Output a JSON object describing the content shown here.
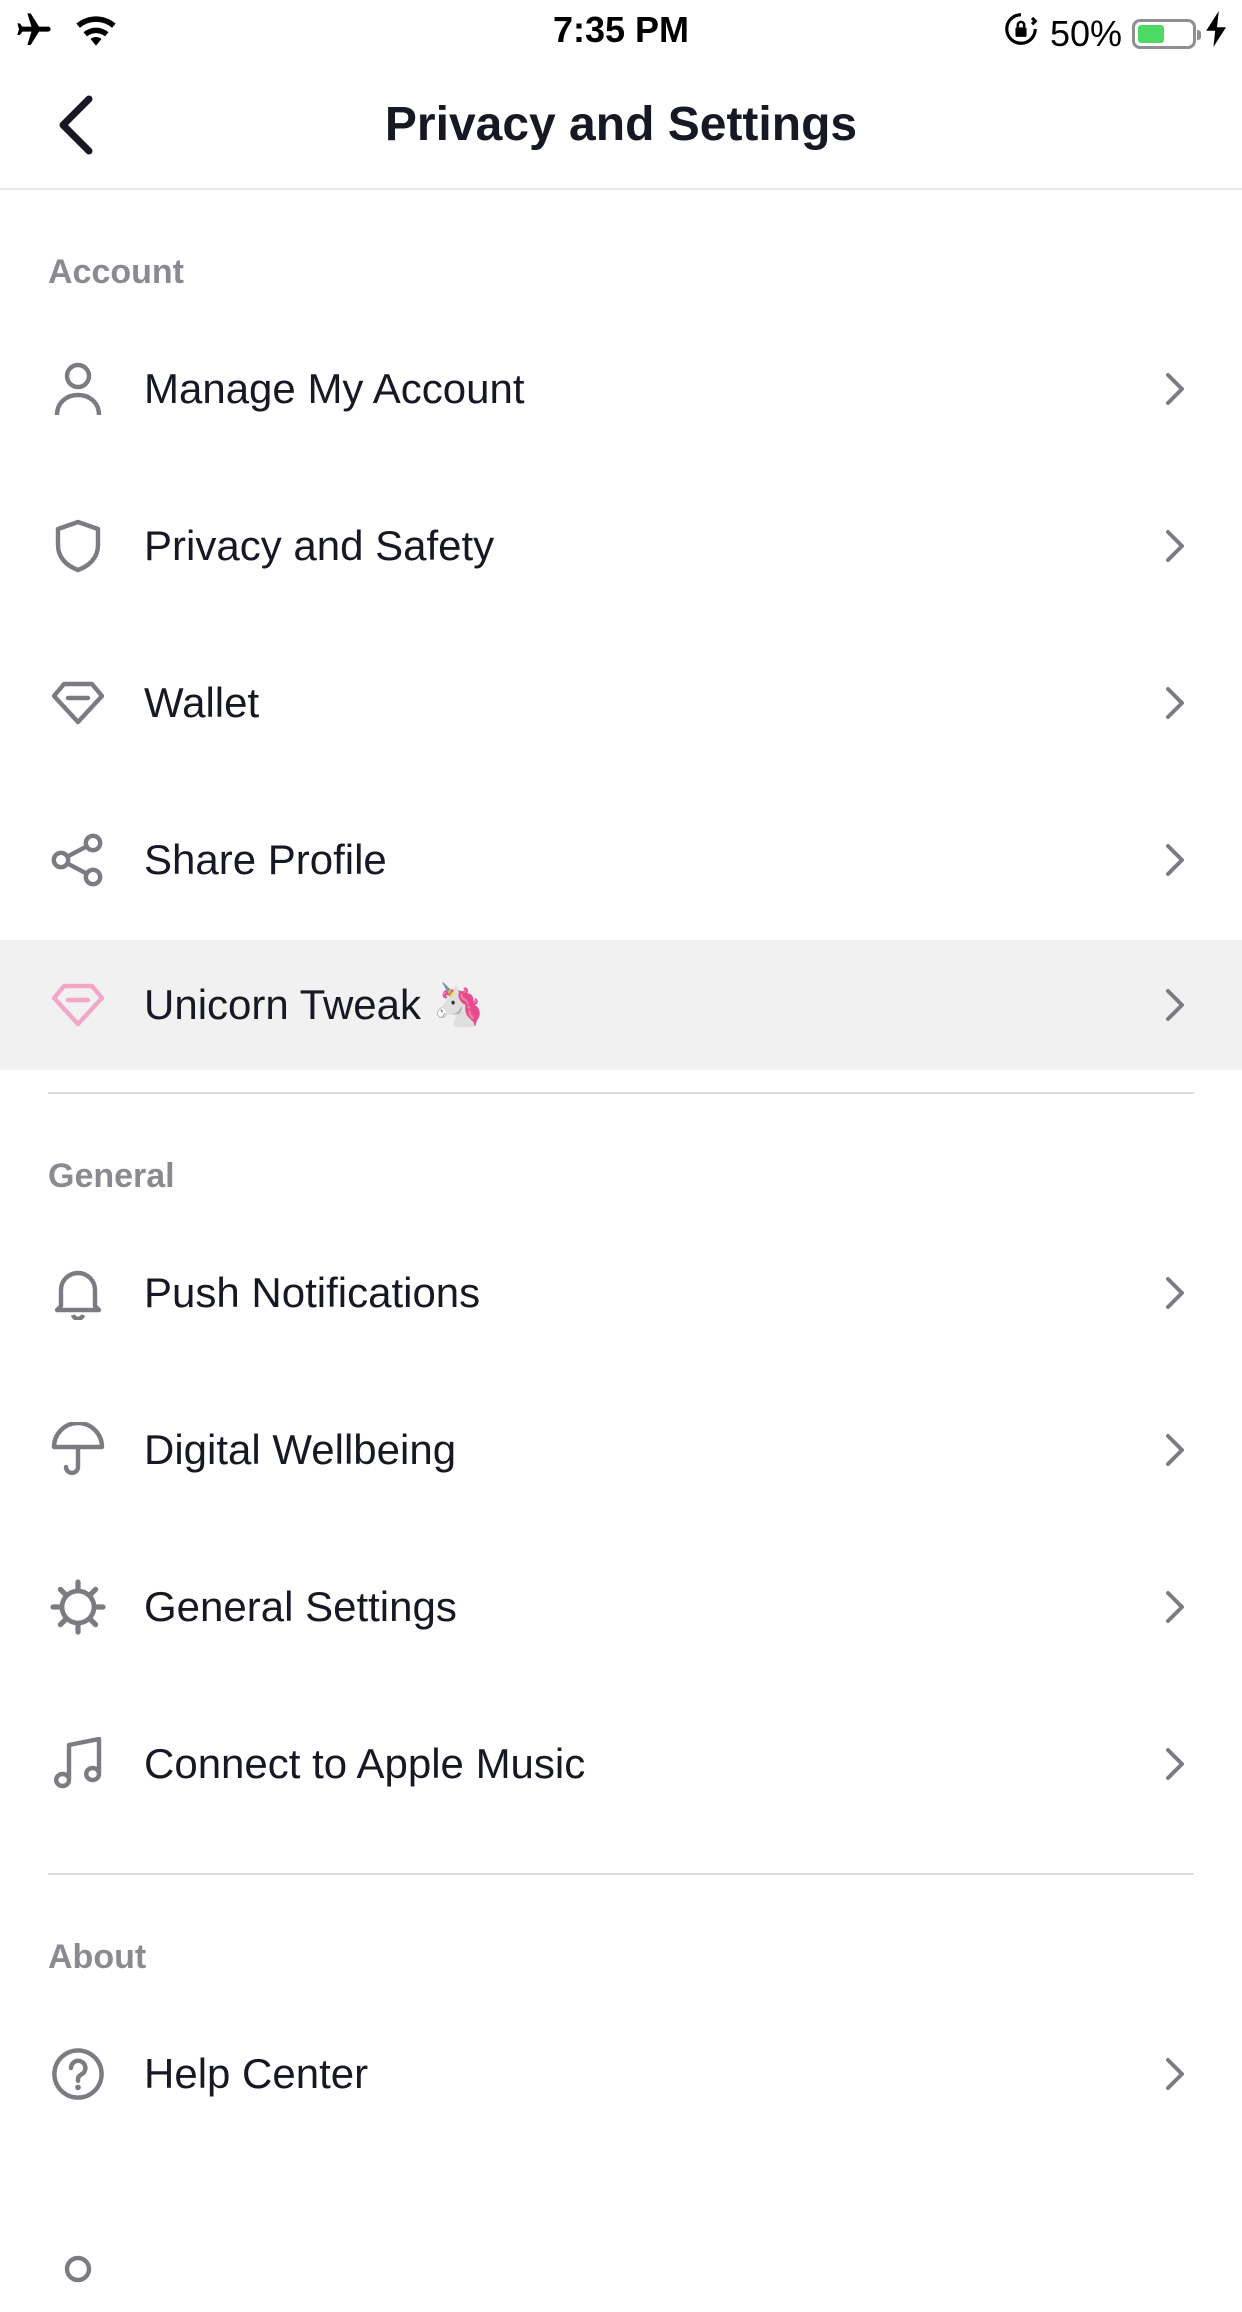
{
  "status_bar": {
    "time": "7:35 PM",
    "battery_percent": "50%",
    "battery_level": 0.5,
    "battery_color": "#4cd964",
    "icons": [
      "airplane-icon",
      "wifi-icon",
      "orientation-lock-icon",
      "battery-icon",
      "charging-bolt-icon"
    ]
  },
  "nav": {
    "title": "Privacy and Settings",
    "back_icon": "chevron-left-icon"
  },
  "sections": {
    "account": {
      "title": "Account",
      "items": [
        {
          "label": "Manage My Account",
          "icon": "person-icon"
        },
        {
          "label": "Privacy and Safety",
          "icon": "shield-icon"
        },
        {
          "label": "Wallet",
          "icon": "diamond-icon"
        },
        {
          "label": "Share Profile",
          "icon": "share-icon"
        },
        {
          "label": "Unicorn Tweak 🦄",
          "icon": "pink-diamond-icon",
          "accent": "#f2a7c6"
        }
      ]
    },
    "general": {
      "title": "General",
      "items": [
        {
          "label": "Push Notifications",
          "icon": "bell-icon"
        },
        {
          "label": "Digital Wellbeing",
          "icon": "umbrella-icon"
        },
        {
          "label": "General Settings",
          "icon": "gear-icon"
        },
        {
          "label": "Connect to Apple Music",
          "icon": "music-note-icon"
        }
      ]
    },
    "about": {
      "title": "About",
      "items": [
        {
          "label": "Help Center",
          "icon": "question-circle-icon"
        }
      ]
    }
  },
  "colors": {
    "text": "#161823",
    "section_header": "#8a8b91",
    "icon": "#7b7c82",
    "highlight_bg": "#f1f1f2"
  }
}
